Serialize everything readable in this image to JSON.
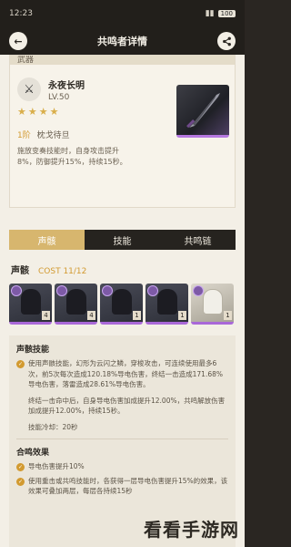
{
  "status": {
    "time": "12:23",
    "battery": "100"
  },
  "header": {
    "title": "共鸣者详情",
    "back_icon": "arrow-left-icon",
    "share_icon": "share-icon"
  },
  "weapon": {
    "section_label": "武器",
    "name": "永夜长明",
    "level": "LV.50",
    "stars": "★★★★",
    "refine_rank": "1阶",
    "refine_name": "枕戈待旦",
    "description": "施放变奏技能时，自身攻击提升8%，防御提升15%，持续15秒。"
  },
  "tabs": [
    {
      "label": "声骸",
      "active": true
    },
    {
      "label": "技能",
      "active": false
    },
    {
      "label": "共鸣链",
      "active": false
    }
  ],
  "echo": {
    "title": "声骸",
    "cost": "COST 11/12",
    "slots": [
      {
        "cost": "4",
        "style": "dark"
      },
      {
        "cost": "4",
        "style": "dark"
      },
      {
        "cost": "1",
        "style": "dark"
      },
      {
        "cost": "1",
        "style": "dark"
      },
      {
        "cost": "1",
        "style": "light"
      }
    ]
  },
  "echo_skill": {
    "title": "声骸技能",
    "para1": "使用声骸技能，幻形为云闪之鳞，穿梭攻击，可连续使用最多6次，前5次每次造成120.18%导电伤害，终结一击造成171.68%导电伤害，落雷造成28.61%导电伤害。",
    "para2": "终结一击命中后，自身导电伤害加成提升12.00%，共鸣解放伤害加成提升12.00%，持续15秒。",
    "cooldown": "技能冷却：20秒"
  },
  "set_effect": {
    "title": "合鸣效果",
    "items": [
      "导电伤害提升10%",
      "使用重击或共鸣技能时，各获得一层导电伤害提升15%的效果，该效果可叠加两层，每层各持续15秒"
    ]
  },
  "watermark": "看看手游网"
}
